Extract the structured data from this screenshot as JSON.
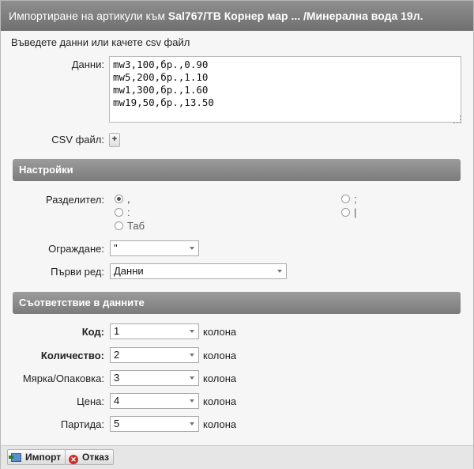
{
  "dialog": {
    "title_prefix": "Импортиране на артикули към ",
    "title_bold": "Sal767/TB Корнер мар ... /Минерална вода 19л."
  },
  "form": {
    "intro": "Въведете данни или качете csv файл",
    "data_label": "Данни:",
    "data_value": "mw3,100,бр.,0.90\nmw5,200,бр.,1.10\nmw1,300,бр.,1.60\nmw19,50,бр.,13.50",
    "csv_label": "CSV файл:",
    "csv_button": "+"
  },
  "settings": {
    "header": "Настройки",
    "delimiter_label": "Разделител:",
    "delimiter_options": [
      {
        "label": ",",
        "selected": true
      },
      {
        "label": ":",
        "selected": false
      },
      {
        "label": "Таб",
        "selected": false
      },
      {
        "label": ";",
        "selected": false
      },
      {
        "label": "|",
        "selected": false
      }
    ],
    "enclosure_label": "Ограждане:",
    "enclosure_value": "\"",
    "first_row_label": "Първи ред:",
    "first_row_value": "Данни"
  },
  "mapping": {
    "header": "Съответствие в данните",
    "unit_word": "колона",
    "fields": [
      {
        "label": "Код:",
        "value": "1",
        "bold": true
      },
      {
        "label": "Количество:",
        "value": "2",
        "bold": true
      },
      {
        "label": "Мярка/Опаковка:",
        "value": "3",
        "bold": false
      },
      {
        "label": "Цена:",
        "value": "4",
        "bold": false
      },
      {
        "label": "Партида:",
        "value": "5",
        "bold": false
      }
    ]
  },
  "footer": {
    "import_label": "Импорт",
    "cancel_label": "Отказ"
  },
  "icons": {
    "import": "import-icon",
    "cancel": "cancel-icon",
    "resize": "resize-grip-icon",
    "dropdown": "chevron-down-icon"
  }
}
